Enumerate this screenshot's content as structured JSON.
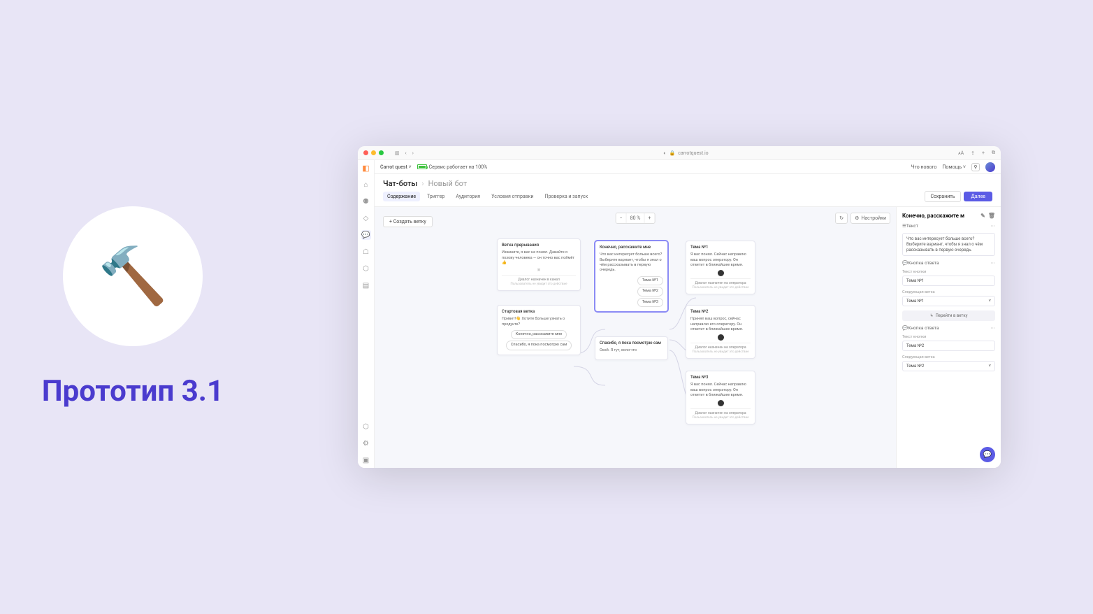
{
  "slide_title": "Прототип 3.1",
  "emoji_hammer": "🔨",
  "browser": {
    "url": "carrotquest.io"
  },
  "topbar": {
    "workspace": "Carrot quest",
    "status": "Сервис работает на 100%",
    "whats_new": "Что нового",
    "help": "Помощь"
  },
  "breadcrumbs": {
    "root": "Чат-боты",
    "current": "Новый бот"
  },
  "tabs": {
    "content": "Содержание",
    "trigger": "Триггер",
    "audience": "Аудитория",
    "conditions": "Условия отправки",
    "check_launch": "Проверка и запуск"
  },
  "actions": {
    "save": "Сохранить",
    "next": "Далее"
  },
  "canvas": {
    "create_branch": "+ Создать ветку",
    "zoom": "80 %",
    "settings": "Настройки"
  },
  "nodes": {
    "interrupt": {
      "title": "Ветка прерывания",
      "text": "Извините, я вас не понял. Давайте я позову человека — он точно вас поймёт 👍",
      "footer": "Диалог назначен в канал",
      "footer_sub": "Пользователь не увидит это действие"
    },
    "start": {
      "title": "Стартовая ветка",
      "text": "Привет!👋\nХотите больше узнать о продукте?",
      "btn1": "Конечно, расскажите мне",
      "btn2": "Спасибо, я пока посмотрю сам"
    },
    "tellme": {
      "title": "Конечно, расскажите мне",
      "text": "Что вас интересует больше всего? Выберите вариант, чтобы я знал о чём рассказывать в первую очередь.",
      "t1": "Тема №1",
      "t2": "Тема №2",
      "t3": "Тема №3"
    },
    "browse": {
      "title": "Спасибо, я пока посмотрю сам",
      "text": "Окей. Я тут, если что"
    },
    "theme1": {
      "title": "Тема №1",
      "text": "Я вас понял. Сейчас направлю ваш вопрос оператору. Он ответит в ближайшее время.",
      "footer": "Диалог назначен на оператора",
      "footer_sub": "Пользователь не увидит это действие"
    },
    "theme2": {
      "title": "Тема №2",
      "text": "Принял ваш вопрос, сейчас направлю его оператору. Он ответит в ближайшее время.",
      "footer": "Диалог назначен на оператора",
      "footer_sub": "Пользователь не увидит это действие"
    },
    "theme3": {
      "title": "Тема №3",
      "text": "Я вас понял. Сейчас направлю ваш вопрос оператору. Он ответит в ближайшее время.",
      "footer": "Диалог назначен на оператора",
      "footer_sub": "Пользователь не увидит это действие"
    }
  },
  "panel": {
    "title": "Конечно, расскажите м",
    "text_label": "Текст",
    "text_body": "Что вас интересует больше всего? Выберите вариант, чтобы я знал о чём рассказывать в первую очередь.",
    "answer_btn_label": "Кнопка ответа",
    "btn_text_label": "Текст кнопки",
    "next_branch_label": "Следующая ветка",
    "btn1_text": "Тема №1",
    "btn1_next": "Тема №1",
    "goto_branch": "Перейти в ветку",
    "btn2_text": "Тема №2",
    "btn2_next": "Тема №2"
  }
}
